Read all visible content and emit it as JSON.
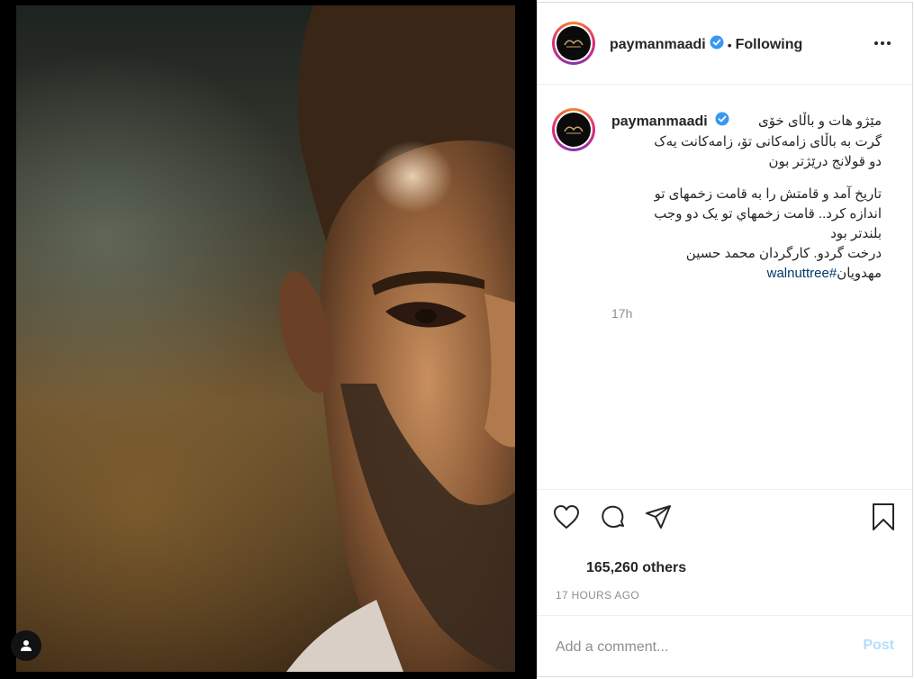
{
  "post": {
    "image_alt": "Close-up photo of a bearded man's face",
    "header": {
      "username": "paymanmaadi",
      "verified_icon": "verified-badge-icon",
      "separator": "•",
      "follow_status": "Following",
      "more_icon": "more-options-icon"
    },
    "caption": {
      "username": "paymanmaadi",
      "line1": "مێژو هات و باڵای خۆی",
      "line2": "گرت بە باڵای زامەکانی تۆ، زامەکانت یەک",
      "line3": "دو قولانج درێژتر بون",
      "para2_line1": "تاریخ آمد و قامتش را به قامت زخمهای تو",
      "para2_line2": "اندازه کرد.. قامت زخمهاي تو یک دو وجب",
      "para2_line3": "بلندتر بود",
      "para2_line4": "درخت گردو. کارگردان محمد حسین",
      "para2_line5_text": "مهدویان",
      "hashtag": "#walnuttree",
      "time": "17h"
    },
    "actions": {
      "like_icon": "heart-icon",
      "comment_icon": "comment-bubble-icon",
      "share_icon": "paper-plane-icon",
      "save_icon": "bookmark-icon"
    },
    "likes_text": "165,260 others",
    "post_date": "17 HOURS AGO",
    "comment": {
      "placeholder": "Add a comment...",
      "post_label": "Post"
    },
    "colors": {
      "text": "#262626",
      "secondary": "#8e8e8e",
      "link": "#00376b",
      "post_disabled": "#b2dffc",
      "verified": "#3897f0"
    }
  }
}
